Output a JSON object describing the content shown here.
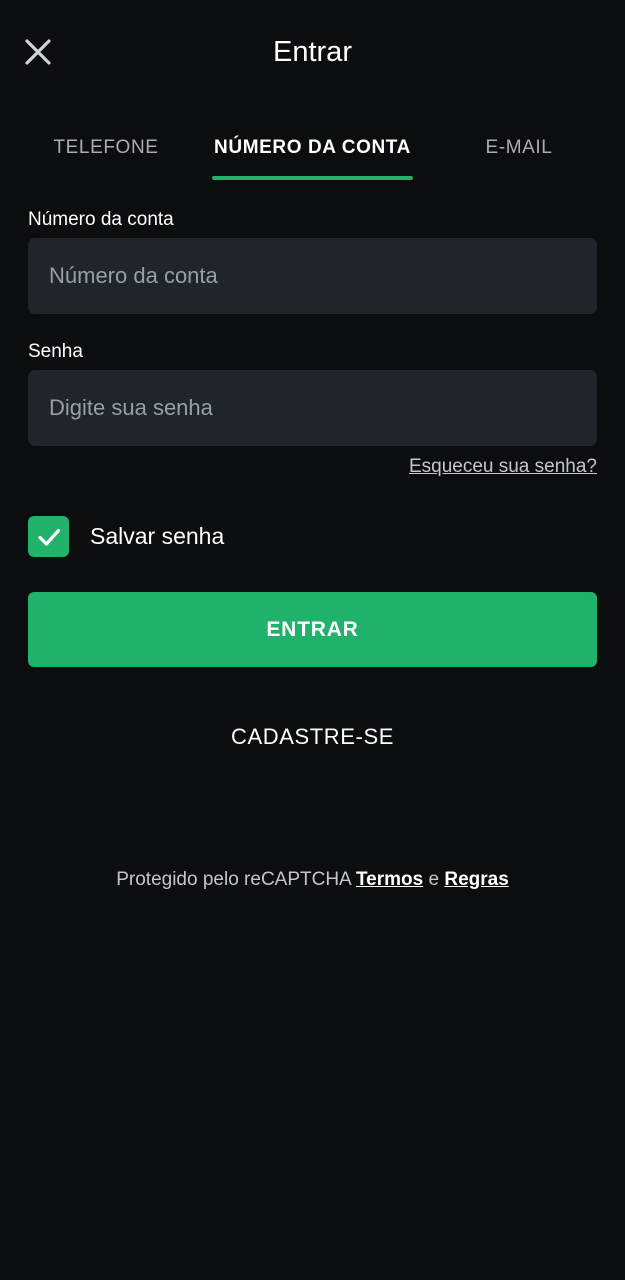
{
  "header": {
    "title": "Entrar",
    "close_icon": "close-icon"
  },
  "tabs": [
    {
      "label": "TELEFONE",
      "active": false
    },
    {
      "label": "NÚMERO DA CONTA",
      "active": true
    },
    {
      "label": "E-MAIL",
      "active": false
    }
  ],
  "form": {
    "account_label": "Número da conta",
    "account_placeholder": "Número da conta",
    "password_label": "Senha",
    "password_placeholder": "Digite sua senha",
    "forgot_password": "Esqueceu sua senha?",
    "save_password_label": "Salvar senha",
    "save_password_checked": true,
    "submit_label": "ENTRAR",
    "register_label": "CADASTRE-SE"
  },
  "footer": {
    "protected_text": "Protegido pelo reCAPTCHA",
    "terms_link": "Termos",
    "conjunction": "e",
    "rules_link": "Regras"
  },
  "colors": {
    "background": "#0b0d0f",
    "accent": "#22b26b",
    "input_background": "#212429"
  }
}
